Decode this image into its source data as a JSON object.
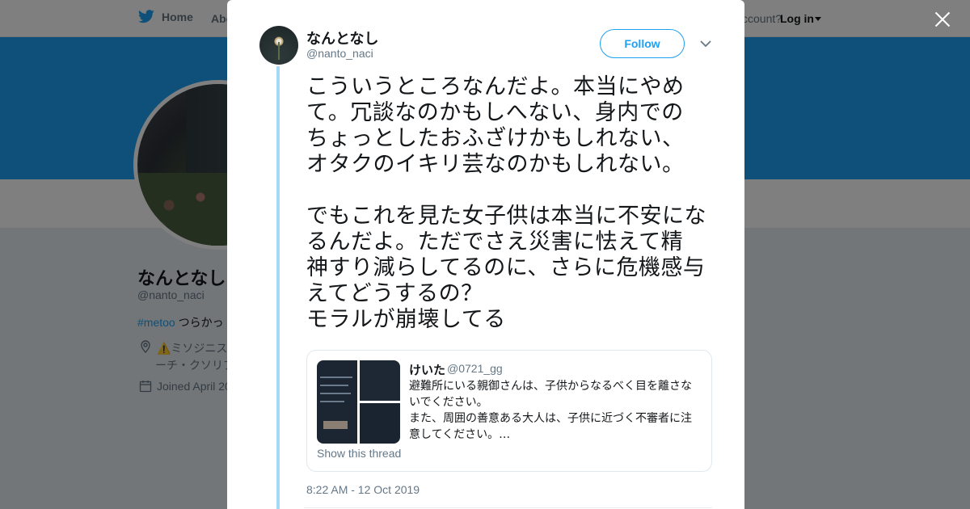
{
  "nav": {
    "home": "Home",
    "about": "Abo",
    "account_prompt": "ccount?",
    "login": "Log in"
  },
  "profile": {
    "name": "なんとなし",
    "handle": "@nanto_naci",
    "bio_tag": "#metoo",
    "bio_text": "つらかっ",
    "location_line1": "⚠️ミソジニス",
    "location_line2": "ーチ・クソリプ",
    "joined": "Joined April 20"
  },
  "tweet": {
    "author_name": "なんとなし",
    "author_handle": "@nanto_naci",
    "follow_label": "Follow",
    "text": "こういうところなんだよ。本当にやめ\nて。冗談なのかもしへない、身内での\nちょっとしたおふざけかもしれない、\nオタクのイキリ芸なのかもしれない。\n\nでもこれを見た女子供は本当に不安にな\nるんだよ。ただでさえ災害に怯えて精\n神すり減らしてるのに、さらに危機感与\nえてどうするの？\nモラルが崩壊してる",
    "timestamp": "8:22 AM - 12 Oct 2019",
    "quote": {
      "name": "けいた",
      "handle": "@0721_gg",
      "text": "避難所にいる親御さんは、子供からなるべく目を離さな\nいでください。\nまた、周囲の善意ある大人は、子供に近づく不審者に注\n意してください。…",
      "show_thread": "Show this thread"
    }
  },
  "colors": {
    "accent": "#1da1f2",
    "thread_line": "#a4d9f9",
    "overlay": "rgba(0,0,0,0.5)"
  },
  "icons": [
    "twitter-bird-icon",
    "close-icon",
    "chevron-down-icon",
    "location-icon",
    "calendar-icon"
  ]
}
